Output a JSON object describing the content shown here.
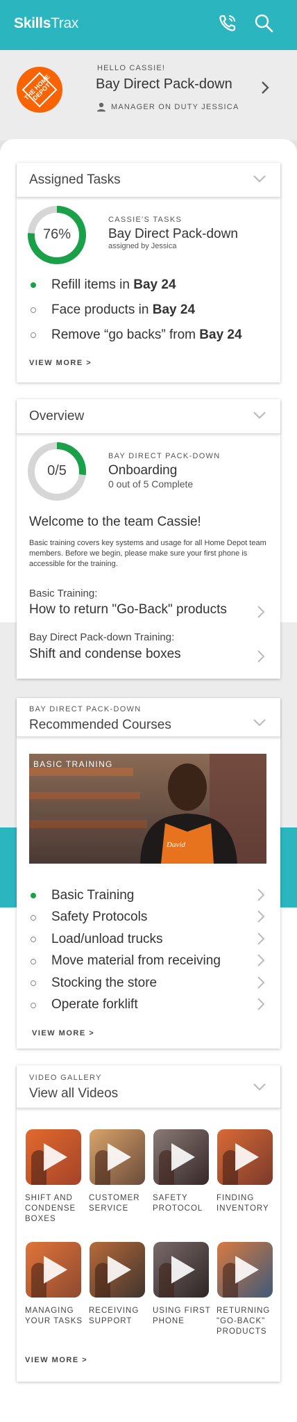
{
  "app": {
    "logo_bold": "Skills",
    "logo_light": "Trax"
  },
  "topbar": {
    "phone_icon": "phone-icon",
    "search_icon": "search-icon",
    "color": "#2bb5be"
  },
  "header": {
    "store_logo_text": "THE HOME DEPOT",
    "greeting": "HELLO CASSIE!",
    "store": "Bay Direct Pack-down",
    "manager": "MANAGER ON DUTY JESSICA"
  },
  "assigned_tasks": {
    "title": "Assigned Tasks",
    "progress_percent": 76,
    "progress_label": "76%",
    "owner": "CASSIE'S TASKS",
    "location": "Bay Direct Pack-down",
    "assigned_by": "assigned by Jessica",
    "tasks": [
      {
        "text": "Refill items in ",
        "bay": "Bay 24",
        "done": true
      },
      {
        "text": "Face products in ",
        "bay": "Bay 24",
        "done": false
      },
      {
        "text": "Remove “go backs” from ",
        "bay": "Bay 24",
        "done": false
      }
    ],
    "view_more": "VIEW MORE >"
  },
  "overview": {
    "title": "Overview",
    "progress_fraction": 0.27,
    "progress_label": "0/5",
    "location": "BAY DIRECT PACK-DOWN",
    "program": "Onboarding",
    "complete": "0 out of 5 Complete",
    "welcome": "Welcome to the team Cassie!",
    "description": "Basic training covers key systems and usage for all Home Depot team members. Before we begin, please make sure your first phone is accessible for the training.",
    "trainings": [
      {
        "category": "Basic Training:",
        "item": "How to return \"Go-Back\" products"
      },
      {
        "category": "Bay Direct Pack-down Training:",
        "item": "Shift and condense boxes"
      }
    ]
  },
  "recommended": {
    "location": "BAY DIRECT PACK-DOWN",
    "title": "Recommended Courses",
    "hero_badge": "BASIC TRAINING",
    "hero_name_tag": "David",
    "courses": [
      {
        "label": "Basic Training",
        "done": true
      },
      {
        "label": "Safety Protocols",
        "done": false
      },
      {
        "label": "Load/unload trucks",
        "done": false
      },
      {
        "label": "Move material from receiving",
        "done": false
      },
      {
        "label": "Stocking the store",
        "done": false
      },
      {
        "label": "Operate forklift",
        "done": false
      }
    ],
    "view_more": "VIEW MORE >"
  },
  "videos": {
    "section": "VIDEO GALLERY",
    "title": "View all Videos",
    "items": [
      {
        "label": "SHIFT AND CONDENSE BOXES"
      },
      {
        "label": "CUSTOMER SERVICE"
      },
      {
        "label": "SAFETY PROTOCOL"
      },
      {
        "label": "FINDING INVENTORY"
      },
      {
        "label": "MANAGING YOUR TASKS"
      },
      {
        "label": "RECEIVING SUPPORT"
      },
      {
        "label": "USING FIRST PHONE"
      },
      {
        "label": "RETURNING \"GO-BACK\" PRODUCTS"
      }
    ],
    "view_more": "VIEW MORE >"
  },
  "colors": {
    "accent": "#2bb5be",
    "progress": "#1aa048",
    "brand_orange": "#f96302"
  }
}
